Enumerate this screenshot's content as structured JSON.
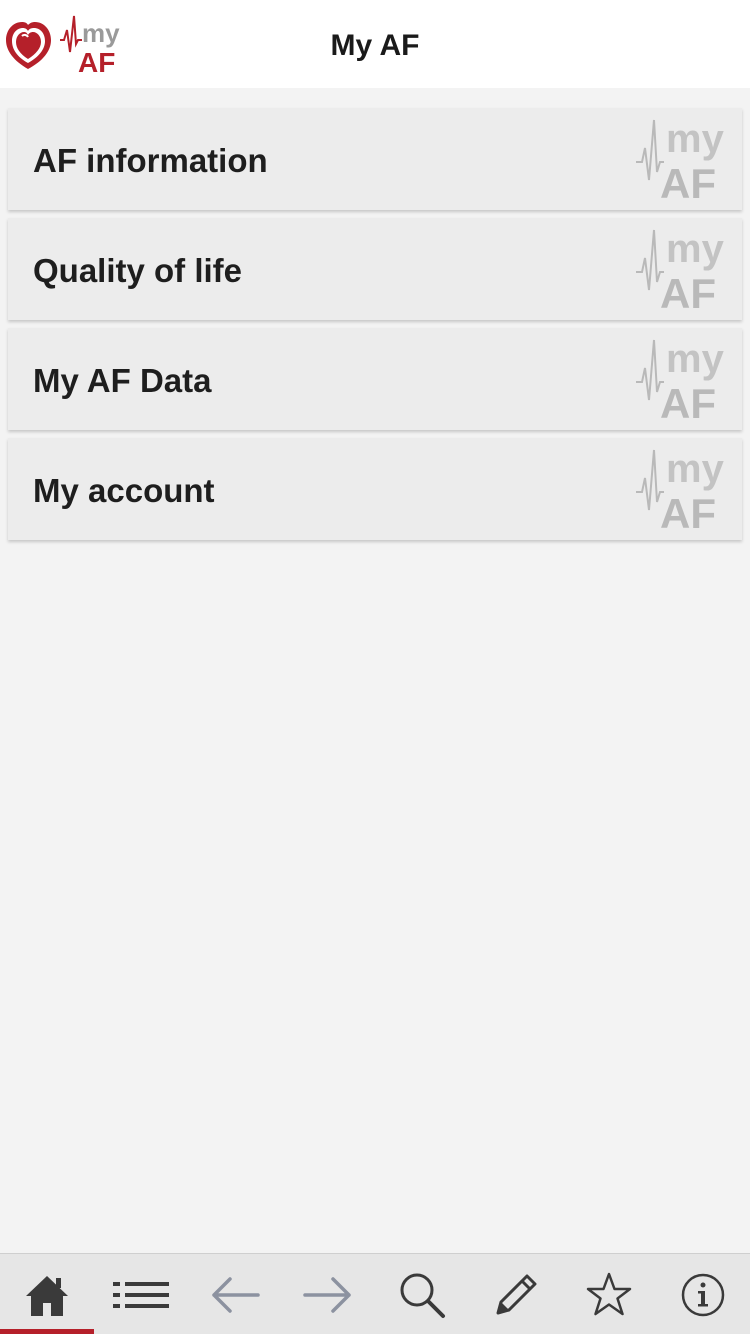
{
  "app": {
    "title": "My AF",
    "logo_text_top": "my",
    "logo_text_bottom": "AF"
  },
  "menu": {
    "items": [
      {
        "label": "AF information"
      },
      {
        "label": "Quality of life"
      },
      {
        "label": "My AF Data"
      },
      {
        "label": "My account"
      }
    ]
  },
  "bottom_nav": {
    "tabs": [
      {
        "icon": "home-icon",
        "active": true
      },
      {
        "icon": "list-icon",
        "active": false
      },
      {
        "icon": "arrow-left-icon",
        "active": false
      },
      {
        "icon": "arrow-right-icon",
        "active": false
      },
      {
        "icon": "search-icon",
        "active": false
      },
      {
        "icon": "pencil-icon",
        "active": false
      },
      {
        "icon": "star-icon",
        "active": false
      },
      {
        "icon": "info-icon",
        "active": false
      }
    ]
  },
  "colors": {
    "brand_red": "#b5202a",
    "header_bg": "#ffffff",
    "page_bg": "#f3f3f3",
    "item_bg": "#ececec",
    "watermark_gray": "#b9b9b9",
    "icon_dark": "#3a3a3a",
    "icon_gray": "#8c92a0",
    "active_indicator": "#b5202a"
  }
}
